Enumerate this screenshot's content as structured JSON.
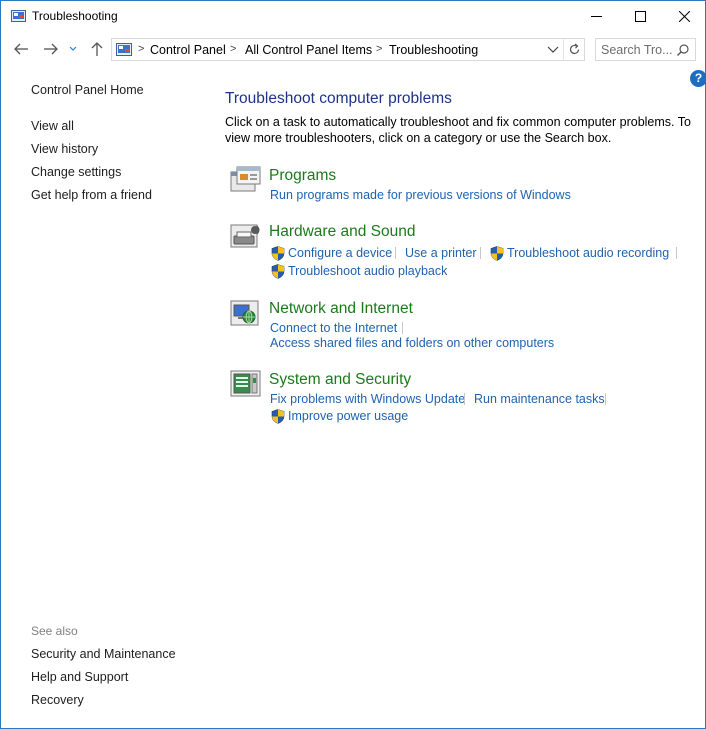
{
  "window": {
    "title": "Troubleshooting"
  },
  "address": {
    "crumbs": [
      "Control Panel",
      "All Control Panel Items",
      "Troubleshooting"
    ]
  },
  "search": {
    "placeholder": "Search Tro..."
  },
  "help": {
    "label": "?"
  },
  "sidebar": {
    "home": "Control Panel Home",
    "links": [
      "View all",
      "View history",
      "Change settings",
      "Get help from a friend"
    ],
    "see_also_heading": "See also",
    "see_also": [
      "Security and Maintenance",
      "Help and Support",
      "Recovery"
    ]
  },
  "main": {
    "title": "Troubleshoot computer problems",
    "description": "Click on a task to automatically troubleshoot and fix common computer problems. To view more troubleshooters, click on a category or use the Search box."
  },
  "categories": [
    {
      "title": "Programs",
      "icon": "programs-icon",
      "tasks": [
        "Run programs made for previous versions of Windows"
      ]
    },
    {
      "title": "Hardware and Sound",
      "icon": "hardware-sound-icon",
      "tasks": [
        "Configure a device",
        "Use a printer",
        "Troubleshoot audio recording",
        "Troubleshoot audio playback"
      ]
    },
    {
      "title": "Network and Internet",
      "icon": "network-internet-icon",
      "tasks": [
        "Connect to the Internet",
        "Access shared files and folders on other computers"
      ]
    },
    {
      "title": "System and Security",
      "icon": "system-security-icon",
      "tasks": [
        "Fix problems with Windows Update",
        "Run maintenance tasks",
        "Improve power usage"
      ]
    }
  ],
  "colors": {
    "link": "#1e63b0",
    "category_title": "#1c7a1c",
    "page_title": "#1e3287",
    "window_border": "#2b79c2"
  }
}
